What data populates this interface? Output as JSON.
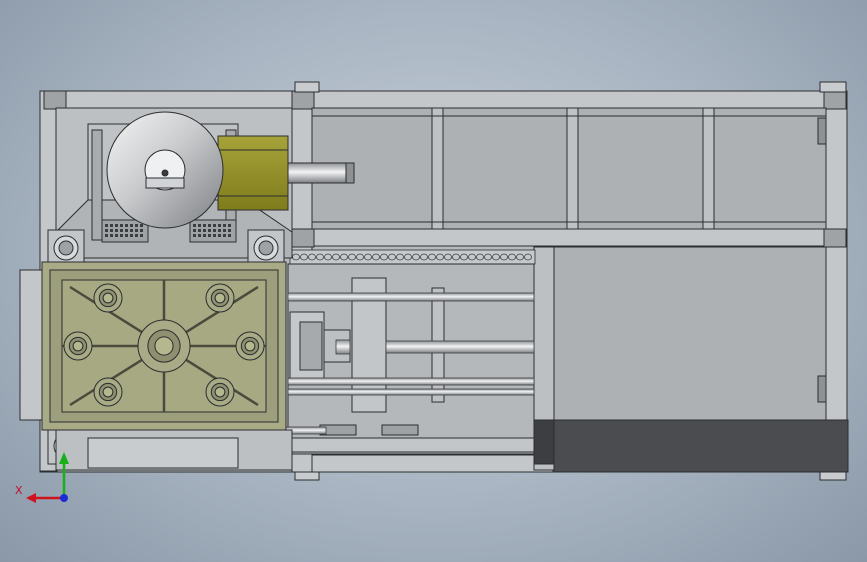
{
  "triad": {
    "x_label": "X",
    "x_color": "#d0121f",
    "y_color": "#16b01a",
    "z_color": "#1b2bd6"
  },
  "colors": {
    "frame": "#b9bcbf",
    "frame_dark": "#3a3d40",
    "panel": "#aeb2b5",
    "housing": "#b8bcbf",
    "motor": "#8c8a22",
    "motor_light": "#a9a63a",
    "mold_plate": "#a9ab86",
    "mold_plate_dark": "#8e9070",
    "steel": "#d6d9dc",
    "base_shadow": "#4a4c4f"
  }
}
